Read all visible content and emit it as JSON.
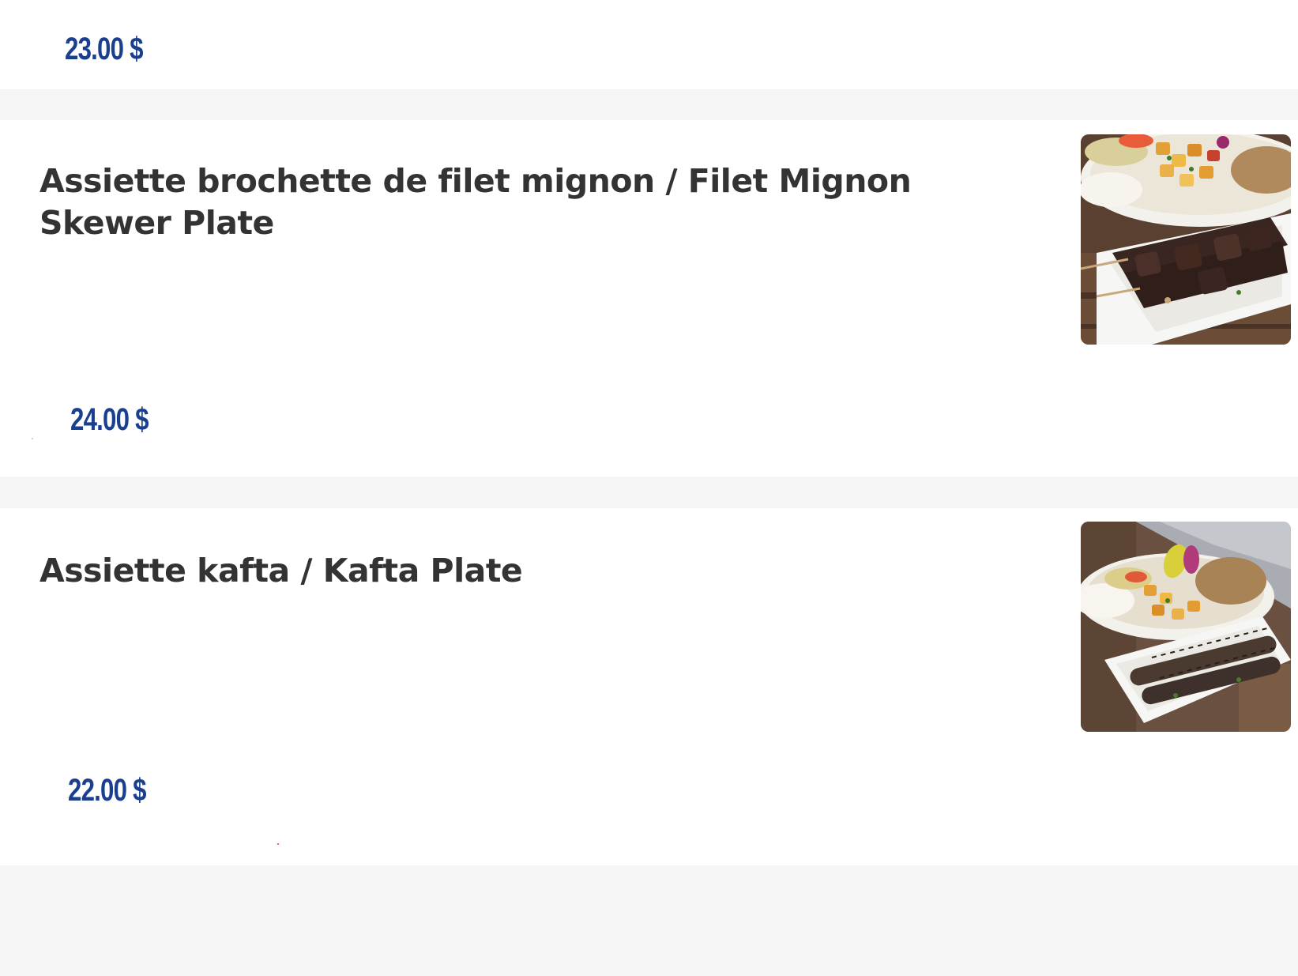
{
  "items": [
    {
      "price": "23.00 $"
    },
    {
      "title": "Assiette brochette de filet mignon / Filet Mignon Skewer Plate",
      "price": "24.00 $",
      "image": "filet-mignon-skewer-plate-photo"
    },
    {
      "title": "Assiette kafta / Kafta Plate",
      "price": "22.00 $",
      "image": "kafta-plate-photo"
    }
  ],
  "colors": {
    "price": "#1a3f8f",
    "title": "#333333",
    "card": "#ffffff",
    "background": "#f5f5f5"
  }
}
